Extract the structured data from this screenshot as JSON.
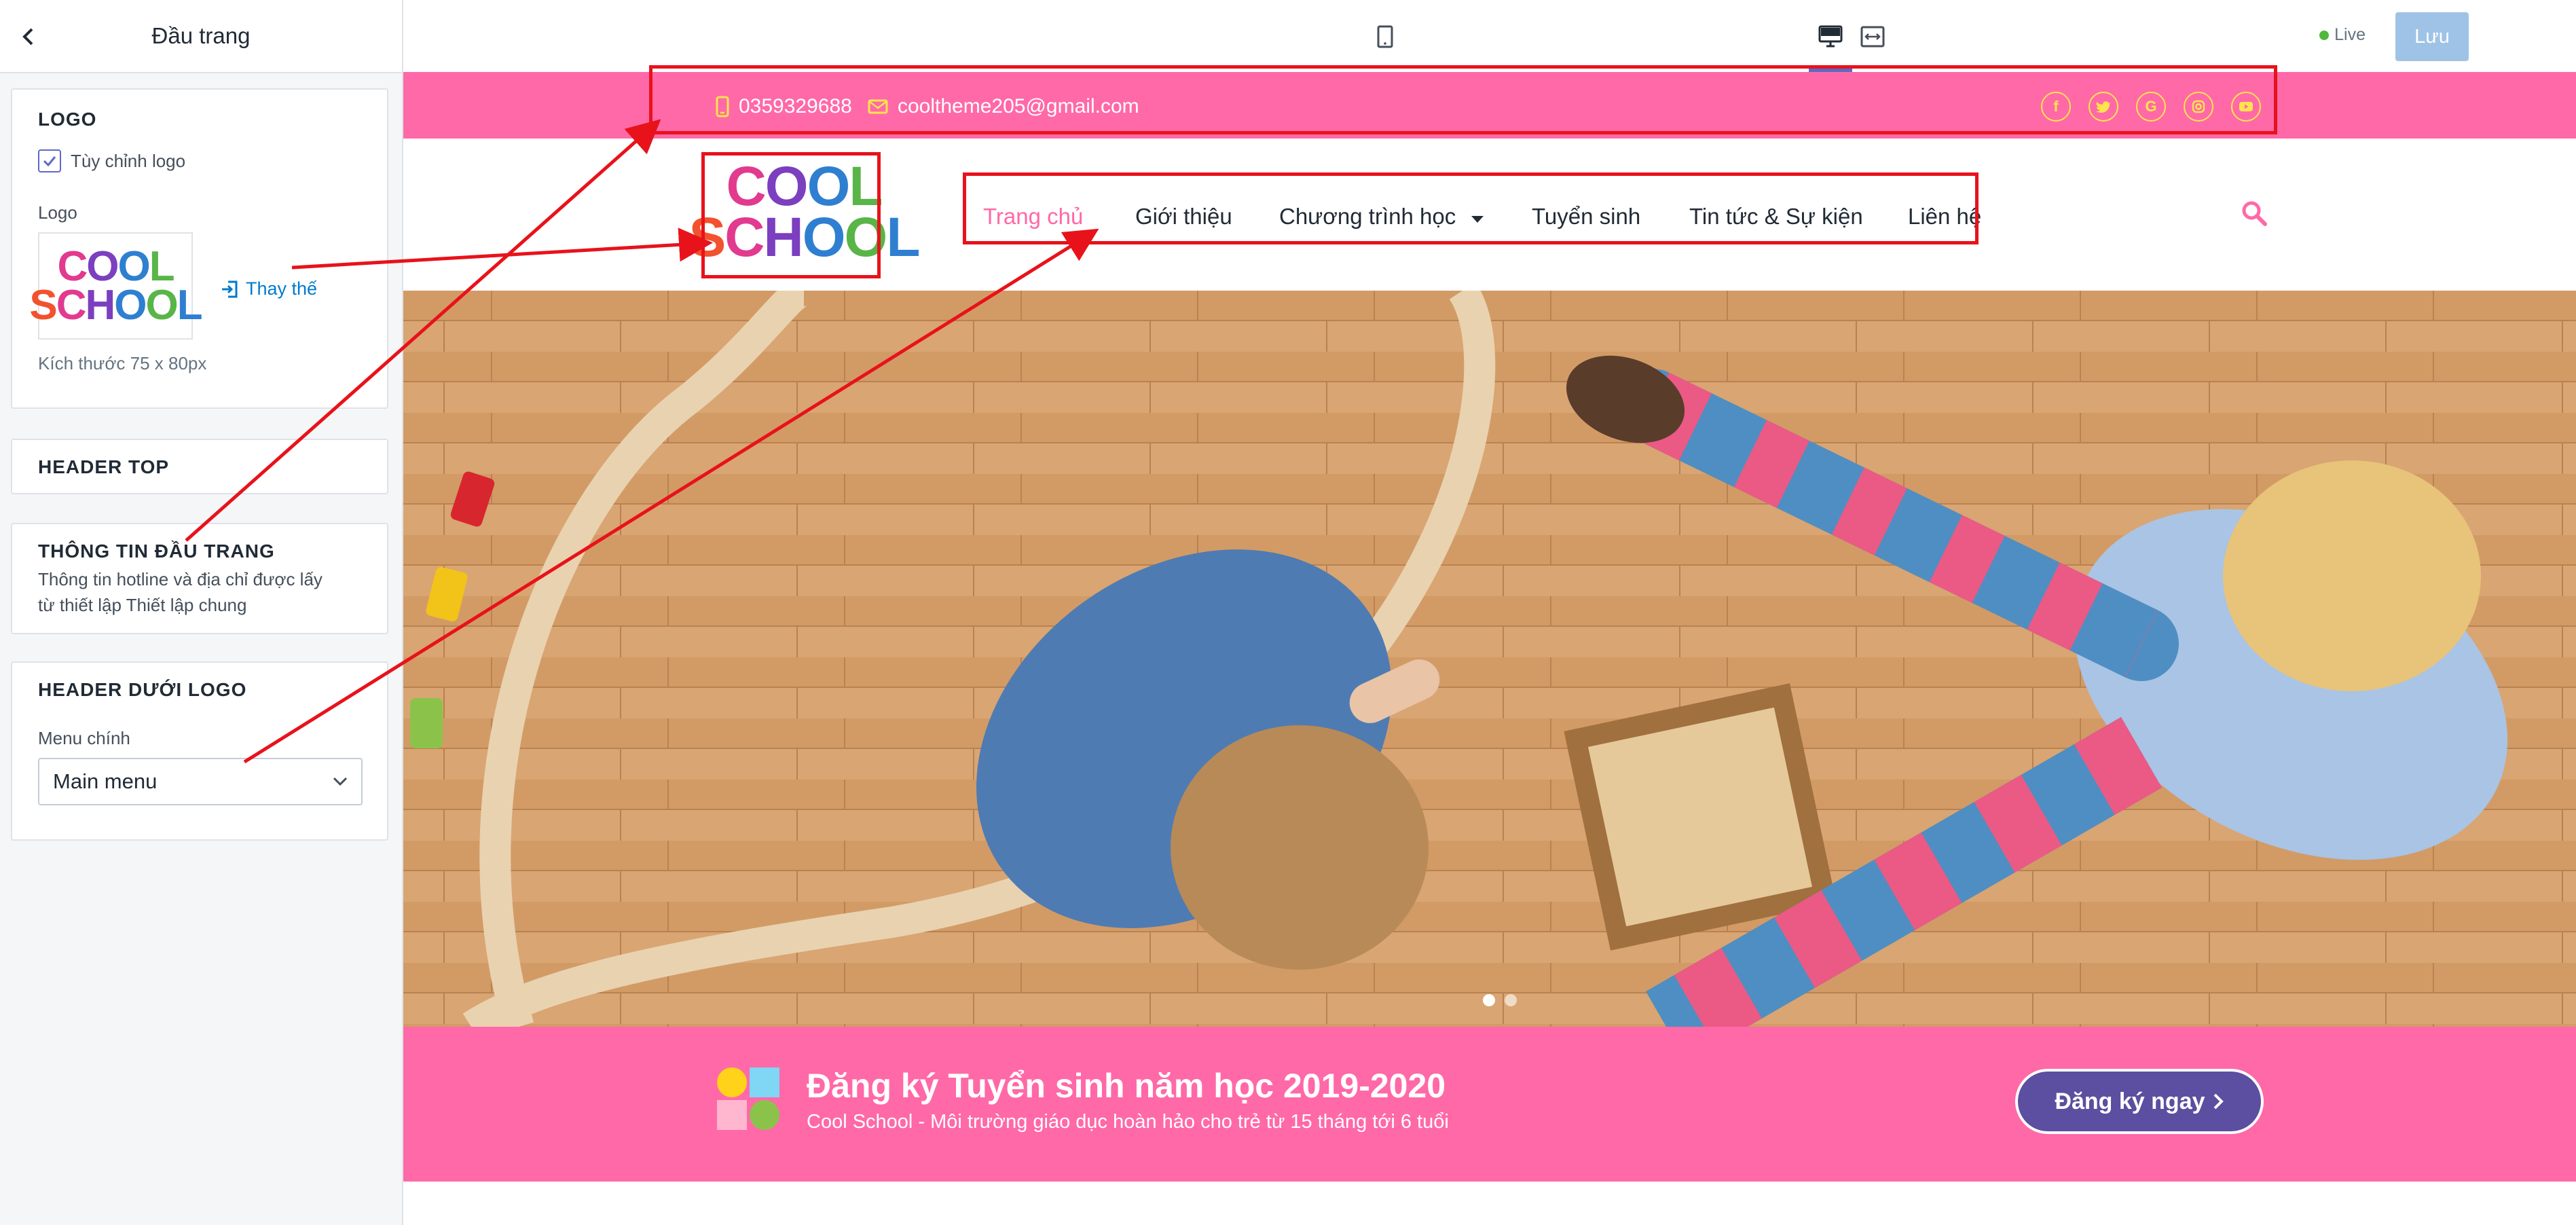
{
  "sidebar": {
    "title": "Đầu trang",
    "logo_section": {
      "heading": "LOGO",
      "custom_logo_label": "Tùy chỉnh logo",
      "custom_logo_checked": true,
      "logo_label": "Logo",
      "replace_label": "Thay thế",
      "size_hint": "Kích thước 75 x 80px"
    },
    "header_top_heading": "HEADER TOP",
    "header_info": {
      "heading": "THÔNG TIN ĐẦU TRANG",
      "description_line1": "Thông tin hotline và địa chỉ được lấy",
      "description_line2": "từ thiết lập Thiết lập chung"
    },
    "header_below_logo": {
      "heading": "HEADER DƯỚI LOGO",
      "menu_label": "Menu chính",
      "menu_value": "Main menu"
    }
  },
  "toolbar": {
    "devices": [
      "mobile-icon",
      "desktop-icon",
      "fullwidth-icon"
    ],
    "active_device": "desktop",
    "live_label": "Live",
    "save_label": "Lưu"
  },
  "site": {
    "phone": "0359329688",
    "email": "cooltheme205@gmail.com",
    "social": [
      "facebook-icon",
      "twitter-icon",
      "google-icon",
      "instagram-icon",
      "youtube-icon"
    ],
    "logo_line1": "COOL",
    "logo_line2": "SCHOOL",
    "nav": [
      "Trang chủ",
      "Giới thiệu",
      "Chương trình học",
      "Tuyển sinh",
      "Tin tức & Sự kiện",
      "Liên hệ"
    ],
    "nav_active_index": 0,
    "slider_dots": 2,
    "slider_active": 0,
    "promo_title": "Đăng ký Tuyển sinh năm học 2019-2020",
    "promo_subtitle": "Cool School - Môi trường giáo dục hoàn hảo cho trẻ từ 15 tháng tới 6 tuổi",
    "promo_button": "Đăng ký ngay"
  },
  "colors": {
    "brand_pink": "#ff69a8",
    "accent_yellow": "#ffe54c",
    "button_purple": "#5c4ea0",
    "annotation_red": "#e8121b",
    "admin_accent": "#5c6ac4"
  }
}
